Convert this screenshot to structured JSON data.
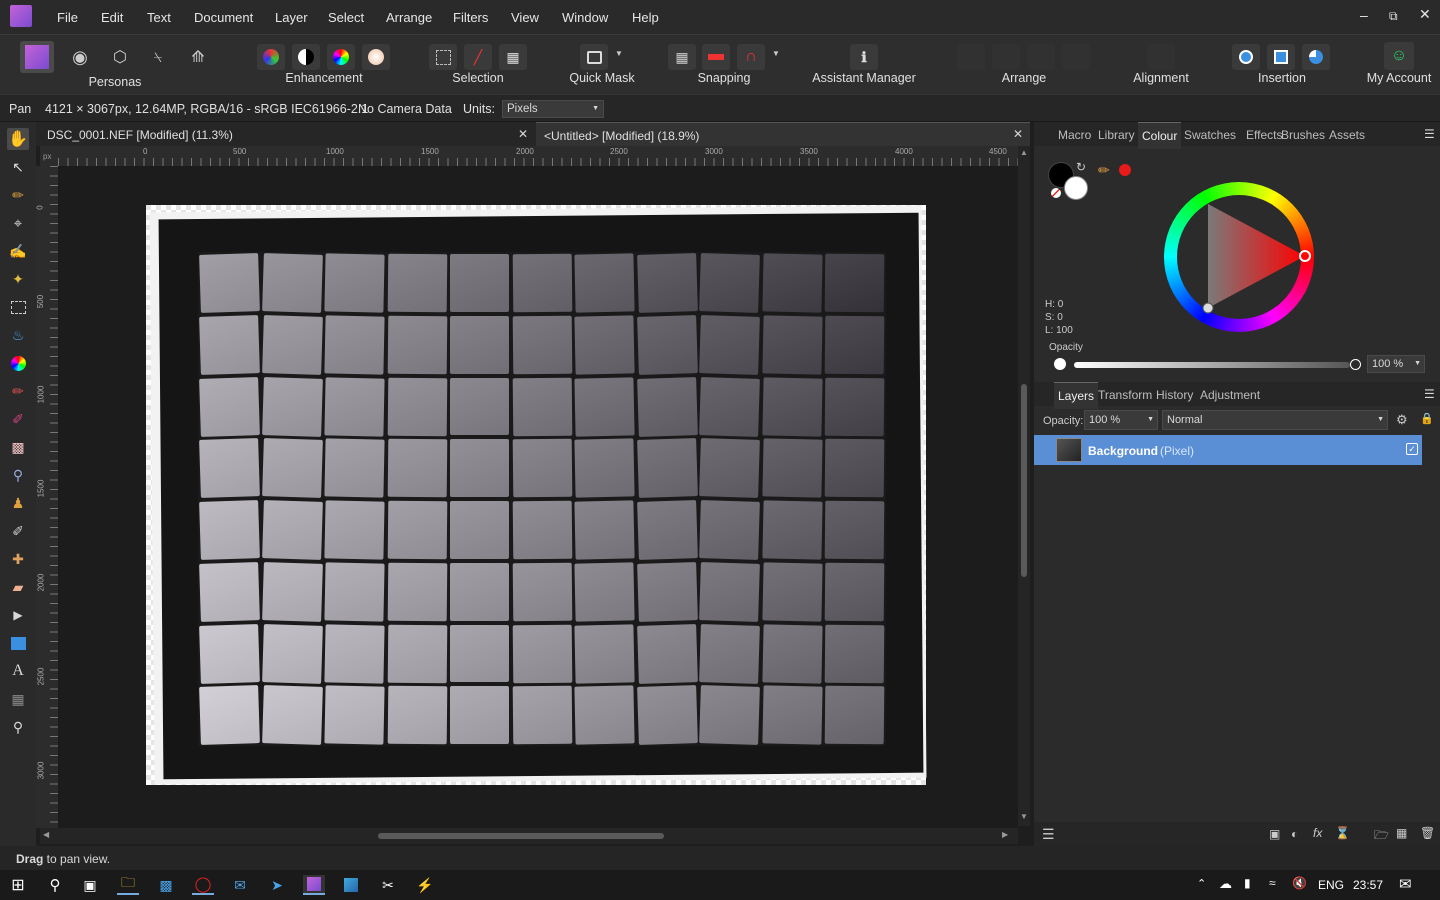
{
  "menubar": {
    "items": [
      "File",
      "Edit",
      "Text",
      "Document",
      "Layer",
      "Select",
      "Arrange",
      "Filters",
      "View",
      "Window",
      "Help"
    ]
  },
  "toolbar": {
    "personas_label": "Personas",
    "enhancement_label": "Enhancement",
    "selection_label": "Selection",
    "quickmask_label": "Quick Mask",
    "snapping_label": "Snapping",
    "assistant_label": "Assistant Manager",
    "arrange_label": "Arrange",
    "alignment_label": "Alignment",
    "insertion_label": "Insertion",
    "account_label": "My Account"
  },
  "context": {
    "tool": "Pan",
    "info": "4121 × 3067px, 12.64MP, RGBA/16 - sRGB IEC61966-2.1",
    "camera": "No Camera Data",
    "units_label": "Units:",
    "units_value": "Pixels"
  },
  "tabs": [
    {
      "title": "DSC_0001.NEF [Modified] (11.3%)"
    },
    {
      "title": "<Untitled> [Modified] (18.9%)"
    }
  ],
  "ruler": {
    "unit": "px",
    "top": [
      "0",
      "500",
      "1000",
      "1500",
      "2000",
      "2500",
      "3000",
      "3500",
      "4000",
      "4500"
    ],
    "left": [
      "0",
      "500",
      "1000",
      "1500",
      "2000",
      "2500",
      "3000"
    ]
  },
  "colour_panel": {
    "tabs": [
      "Macro",
      "Library",
      "Colour",
      "Swatches",
      "Effects",
      "Brushes",
      "Assets"
    ],
    "active": "Colour",
    "h": "H: 0",
    "s": "S: 0",
    "l": "L: 100",
    "opacity_label": "Opacity",
    "opacity_value": "100 %",
    "accent": "#e81a1a"
  },
  "layers_panel": {
    "tabs": [
      "Layers",
      "Transform",
      "History",
      "Adjustment"
    ],
    "active": "Layers",
    "opacity_label": "Opacity:",
    "opacity_value": "100 %",
    "blend": "Normal",
    "layer_name": "Background",
    "layer_type": "(Pixel)",
    "selected_color": "#5a8fd6"
  },
  "status": {
    "bold": "Drag",
    "rest": " to pan view."
  },
  "taskbar": {
    "lang": "ENG",
    "time": "23:57"
  }
}
